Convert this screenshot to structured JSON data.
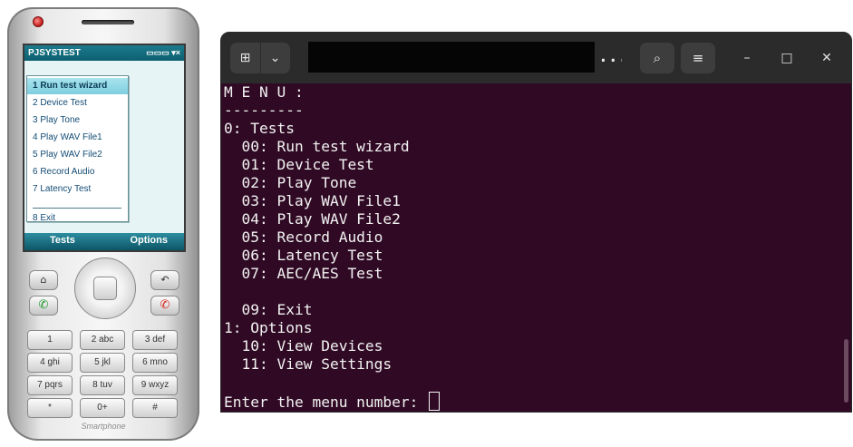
{
  "phone": {
    "app_title": "PJSYSTEST",
    "indicators": "▭▭▭ ▾×",
    "menu_items": [
      "1 Run test wizard",
      "2 Device Test",
      "3 Play Tone",
      "4 Play WAV File1",
      "5 Play WAV File2",
      "6 Record Audio",
      "7 Latency Test",
      "8 Exit"
    ],
    "softkey_left": "Tests",
    "softkey_right": "Options",
    "nav_keys": {
      "home": "⌂",
      "back": "↶",
      "call": "✆",
      "end": "✆"
    },
    "keys": [
      "1",
      "2 abc",
      "3 def",
      "4 ghi",
      "5 jkl",
      "6 mno",
      "7 pqrs",
      "8 tuv",
      "9 wxyz",
      "*",
      "0+",
      "#"
    ],
    "brand": "Smartphone"
  },
  "terminal": {
    "new_tab_icon": "⊞",
    "dropdown_icon": "⌄",
    "title_visible": "...",
    "search_icon": "⌕",
    "menu_icon": "≡",
    "minimize_icon": "–",
    "maximize_icon": "□",
    "close_icon": "✕",
    "lines": [
      "M E N U :",
      "---------",
      "0: Tests",
      "  00: Run test wizard",
      "  01: Device Test",
      "  02: Play Tone",
      "  03: Play WAV File1",
      "  04: Play WAV File2",
      "  05: Record Audio",
      "  06: Latency Test",
      "  07: AEC/AES Test",
      "",
      "  09: Exit",
      "1: Options",
      "  10: View Devices",
      "  11: View Settings",
      ""
    ],
    "prompt": "Enter the menu number: "
  }
}
